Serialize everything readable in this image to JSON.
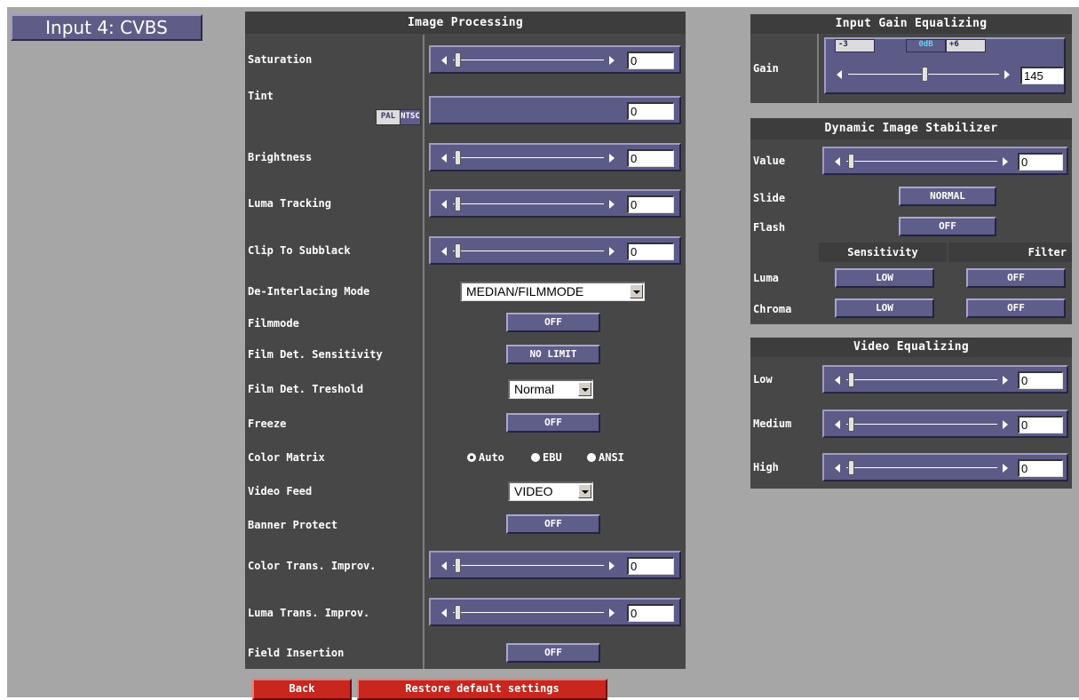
{
  "input_title": "Input 4: CVBS",
  "image_processing": {
    "title": "Image Processing",
    "saturation": {
      "label": "Saturation",
      "value": "0"
    },
    "tint": {
      "label": "Tint",
      "pal": "PAL",
      "ntsc": "NTSC",
      "value": "0"
    },
    "brightness": {
      "label": "Brightness",
      "value": "0"
    },
    "luma_tracking": {
      "label": "Luma Tracking",
      "value": "0"
    },
    "clip_to_subblack": {
      "label": "Clip To Subblack",
      "value": "0"
    },
    "deinterlacing": {
      "label": "De-Interlacing Mode",
      "value": "MEDIAN/FILMMODE"
    },
    "filmmode": {
      "label": "Filmmode",
      "value": "OFF"
    },
    "film_det_sensitivity": {
      "label": "Film Det. Sensitivity",
      "value": "NO LIMIT"
    },
    "film_det_treshold": {
      "label": "Film Det. Treshold",
      "value": "Normal"
    },
    "freeze": {
      "label": "Freeze",
      "value": "OFF"
    },
    "color_matrix": {
      "label": "Color Matrix",
      "options": [
        "Auto",
        "EBU",
        "ANSI"
      ],
      "selected": "Auto"
    },
    "video_feed": {
      "label": "Video Feed",
      "value": "VIDEO"
    },
    "banner_protect": {
      "label": "Banner Protect",
      "value": "OFF"
    },
    "color_trans": {
      "label": "Color Trans. Improv.",
      "value": "0"
    },
    "luma_trans": {
      "label": "Luma Trans. Improv.",
      "value": "0"
    },
    "field_insertion": {
      "label": "Field Insertion",
      "value": "OFF"
    }
  },
  "buttons": {
    "back": "Back",
    "restore": "Restore default settings"
  },
  "input_gain": {
    "title": "Input Gain Equalizing",
    "gain": {
      "label": "Gain",
      "scale": [
        "-3",
        "0dB",
        "+6"
      ],
      "value": "145"
    }
  },
  "dis": {
    "title": "Dynamic Image Stabilizer",
    "value": {
      "label": "Value",
      "value": "0"
    },
    "slide": {
      "label": "Slide",
      "value": "NORMAL"
    },
    "flash": {
      "label": "Flash",
      "value": "OFF"
    },
    "sensitivity_header": "Sensitivity",
    "filter_header": "Filter",
    "luma": {
      "label": "Luma",
      "sensitivity": "LOW",
      "filter": "OFF"
    },
    "chroma": {
      "label": "Chroma",
      "sensitivity": "LOW",
      "filter": "OFF"
    }
  },
  "video_eq": {
    "title": "Video Equalizing",
    "low": {
      "label": "Low",
      "value": "0"
    },
    "medium": {
      "label": "Medium",
      "value": "0"
    },
    "high": {
      "label": "High",
      "value": "0"
    }
  }
}
